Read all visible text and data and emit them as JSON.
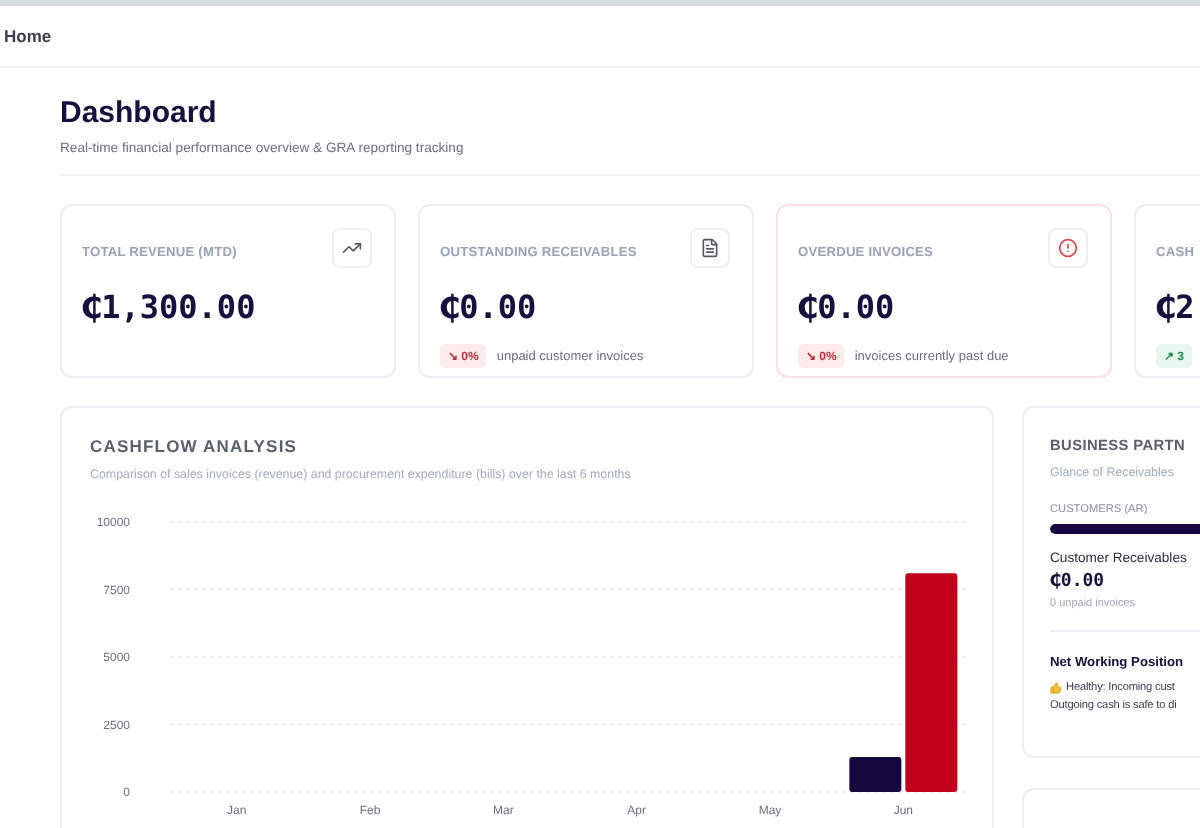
{
  "topbar": {
    "breadcrumb": "Home"
  },
  "header": {
    "title": "Dashboard",
    "subtitle": "Real-time financial performance overview & GRA reporting tracking"
  },
  "kpis": [
    {
      "label": "TOTAL REVENUE (MTD)",
      "value": "₵1,300.00",
      "alert": false
    },
    {
      "label": "OUTSTANDING RECEIVABLES",
      "value": "₵0.00",
      "alert": false,
      "badge": {
        "positive": false,
        "text": "↘ 0%"
      },
      "note": "unpaid customer invoices"
    },
    {
      "label": "OVERDUE INVOICES",
      "value": "₵0.00",
      "alert": true,
      "badge": {
        "positive": false,
        "text": "↘ 0%"
      },
      "note": "invoices currently past due"
    },
    {
      "label": "CASH",
      "value": "₵2",
      "alert": false,
      "badge": {
        "positive": true,
        "text": "↗ 3"
      }
    }
  ],
  "cashflow": {
    "title": "CASHFLOW ANALYSIS",
    "subtitle": "Comparison of sales invoices (revenue) and procurement expenditure (bills) over the last 6 months",
    "chart_data": {
      "type": "bar",
      "categories": [
        "Jan",
        "Feb",
        "Mar",
        "Apr",
        "May",
        "Jun"
      ],
      "series": [
        {
          "color": "#14083f",
          "values": [
            0,
            0,
            0,
            0,
            0,
            1300
          ]
        },
        {
          "color": "#c0001a",
          "values": [
            0,
            0,
            0,
            0,
            0,
            8100
          ]
        }
      ],
      "grid": true,
      "ylim": [
        0,
        10000
      ],
      "yticks": [
        0,
        2500,
        5000,
        7500,
        10000
      ]
    }
  },
  "partners": {
    "title": "BUSINESS PARTN",
    "subtitle": "Glance of Receivables",
    "bar_label": "CUSTOMERS (AR)",
    "level": 1,
    "receivables_label": "Customer Receivables",
    "receivables_value": "₵0.00",
    "receivables_note": "0 unpaid invoices",
    "position_title": "Net Working Position",
    "position_lines": [
      "Healthy: Incoming cust",
      "Outgoing cash is safe to di"
    ]
  }
}
